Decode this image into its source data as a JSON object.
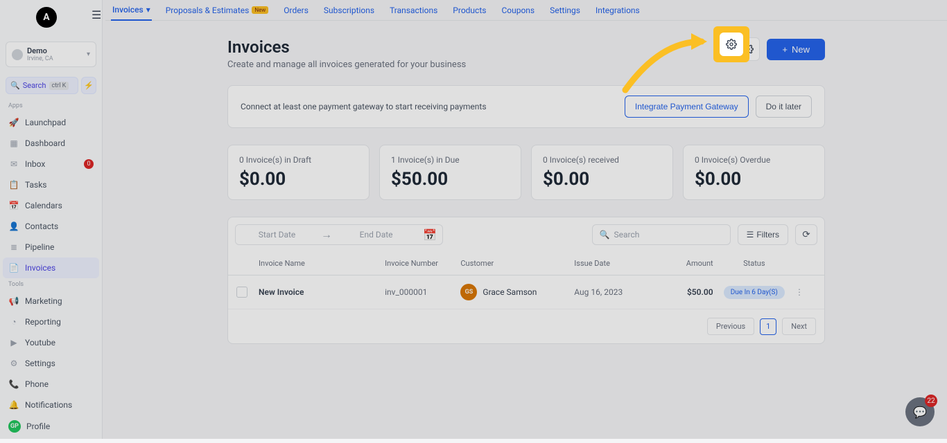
{
  "brand": {
    "letter": "A"
  },
  "workspace": {
    "name": "Demo",
    "location": "Irvine, CA"
  },
  "search": {
    "label": "Search",
    "shortcut": "ctrl K"
  },
  "sidebar": {
    "apps_label": "Apps",
    "tools_label": "Tools",
    "items": {
      "launchpad": "Launchpad",
      "dashboard": "Dashboard",
      "inbox": "Inbox",
      "inbox_badge": "0",
      "tasks": "Tasks",
      "calendars": "Calendars",
      "contacts": "Contacts",
      "pipeline": "Pipeline",
      "invoices": "Invoices",
      "marketing": "Marketing",
      "reporting": "Reporting",
      "youtube": "Youtube",
      "settings": "Settings",
      "phone": "Phone",
      "notifications": "Notifications",
      "profile": "Profile",
      "profile_initials": "GP"
    }
  },
  "topnav": {
    "invoices": "Invoices",
    "proposals": "Proposals & Estimates",
    "new_badge": "New",
    "orders": "Orders",
    "subscriptions": "Subscriptions",
    "transactions": "Transactions",
    "products": "Products",
    "coupons": "Coupons",
    "settings": "Settings",
    "integrations": "Integrations"
  },
  "page": {
    "title": "Invoices",
    "subtitle": "Create and manage all invoices generated for your business",
    "new_btn": "New"
  },
  "alert": {
    "text": "Connect at least one payment gateway to start receiving payments",
    "integrate": "Integrate Payment Gateway",
    "later": "Do it later"
  },
  "stats": [
    {
      "label": "0 Invoice(s) in Draft",
      "value": "$0.00"
    },
    {
      "label": "1 Invoice(s) in Due",
      "value": "$50.00"
    },
    {
      "label": "0 Invoice(s) received",
      "value": "$0.00"
    },
    {
      "label": "0 Invoice(s) Overdue",
      "value": "$0.00"
    }
  ],
  "filters": {
    "start": "Start Date",
    "end": "End Date",
    "search": "Search",
    "filters_btn": "Filters"
  },
  "table": {
    "headers": {
      "name": "Invoice Name",
      "number": "Invoice Number",
      "customer": "Customer",
      "date": "Issue Date",
      "amount": "Amount",
      "status": "Status"
    },
    "rows": [
      {
        "name": "New Invoice",
        "number": "inv_000001",
        "customer": "Grace Samson",
        "initials": "GS",
        "date": "Aug 16, 2023",
        "amount": "$50.00",
        "status": "Due In 6 Day(S)"
      }
    ]
  },
  "pagination": {
    "previous": "Previous",
    "page": "1",
    "next": "Next"
  },
  "chat": {
    "count": "22"
  }
}
